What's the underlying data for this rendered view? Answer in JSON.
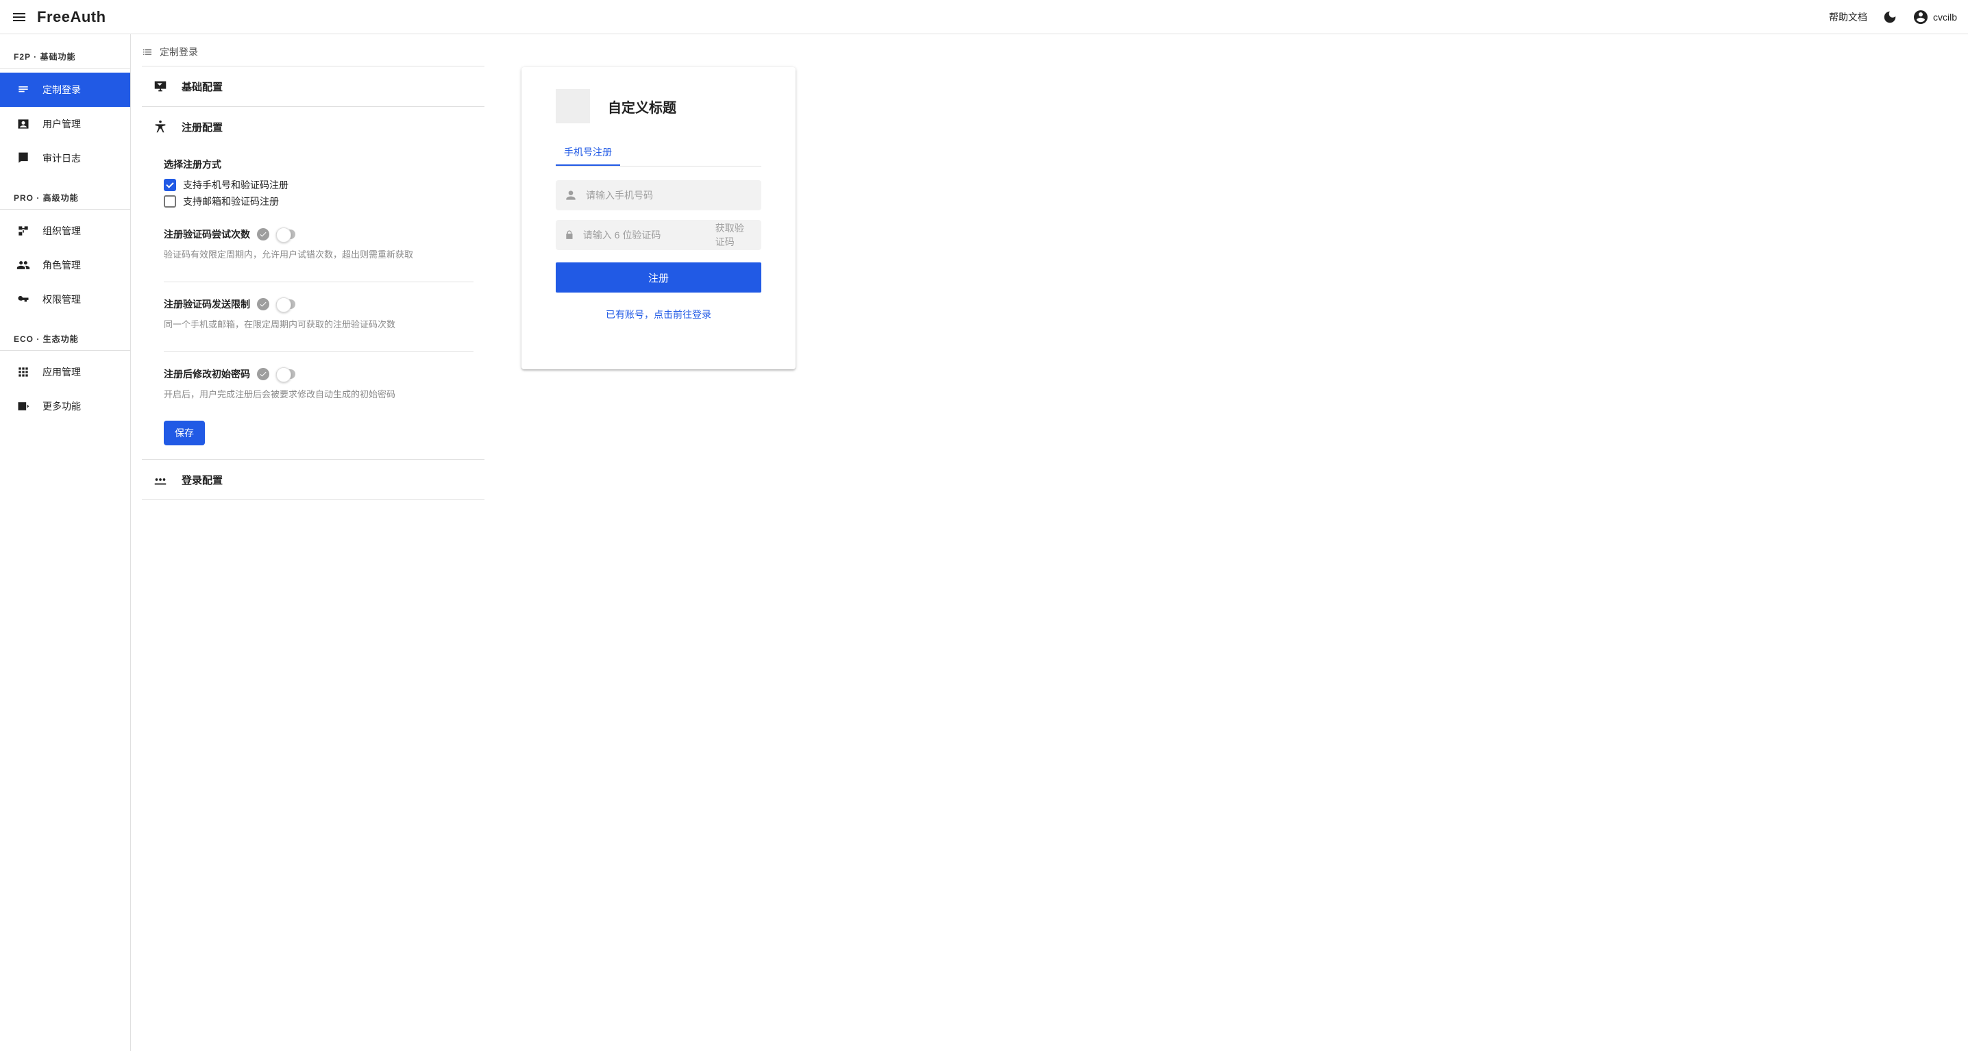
{
  "header": {
    "logo": "FreeAuth",
    "help_label": "帮助文档",
    "username": "cvcilb"
  },
  "sidebar": {
    "groups": [
      {
        "label": "F2P · 基础功能",
        "items": [
          {
            "label": "定制登录",
            "icon": "login-settings-icon",
            "active": true
          },
          {
            "label": "用户管理",
            "icon": "user-card-icon"
          },
          {
            "label": "审计日志",
            "icon": "log-icon"
          }
        ]
      },
      {
        "label": "PRO · 高级功能",
        "items": [
          {
            "label": "组织管理",
            "icon": "org-icon"
          },
          {
            "label": "角色管理",
            "icon": "group-icon"
          },
          {
            "label": "权限管理",
            "icon": "key-icon"
          }
        ]
      },
      {
        "label": "ECO · 生态功能",
        "items": [
          {
            "label": "应用管理",
            "icon": "apps-icon"
          },
          {
            "label": "更多功能",
            "icon": "more-icon"
          }
        ]
      }
    ]
  },
  "breadcrumb": {
    "title": "定制登录"
  },
  "sections": {
    "basic": {
      "title": "基础配置"
    },
    "signup": {
      "title": "注册配置",
      "method": {
        "title": "选择注册方式",
        "opt_phone": "支持手机号和验证码注册",
        "opt_email": "支持邮箱和验证码注册"
      },
      "attempts": {
        "title": "注册验证码尝试次数",
        "desc": "验证码有效限定周期内，允许用户试错次数，超出则需重新获取"
      },
      "send_limit": {
        "title": "注册验证码发送限制",
        "desc": "同一个手机或邮箱，在限定周期内可获取的注册验证码次数"
      },
      "reset_pwd": {
        "title": "注册后修改初始密码",
        "desc": "开启后，用户完成注册后会被要求修改自动生成的初始密码"
      },
      "save_label": "保存"
    },
    "login": {
      "title": "登录配置"
    }
  },
  "preview": {
    "title": "自定义标题",
    "tab_phone": "手机号注册",
    "phone_placeholder": "请输入手机号码",
    "code_placeholder": "请输入 6 位验证码",
    "get_code_label": "获取验证码",
    "register_label": "注册",
    "login_link": "已有账号，点击前往登录"
  }
}
